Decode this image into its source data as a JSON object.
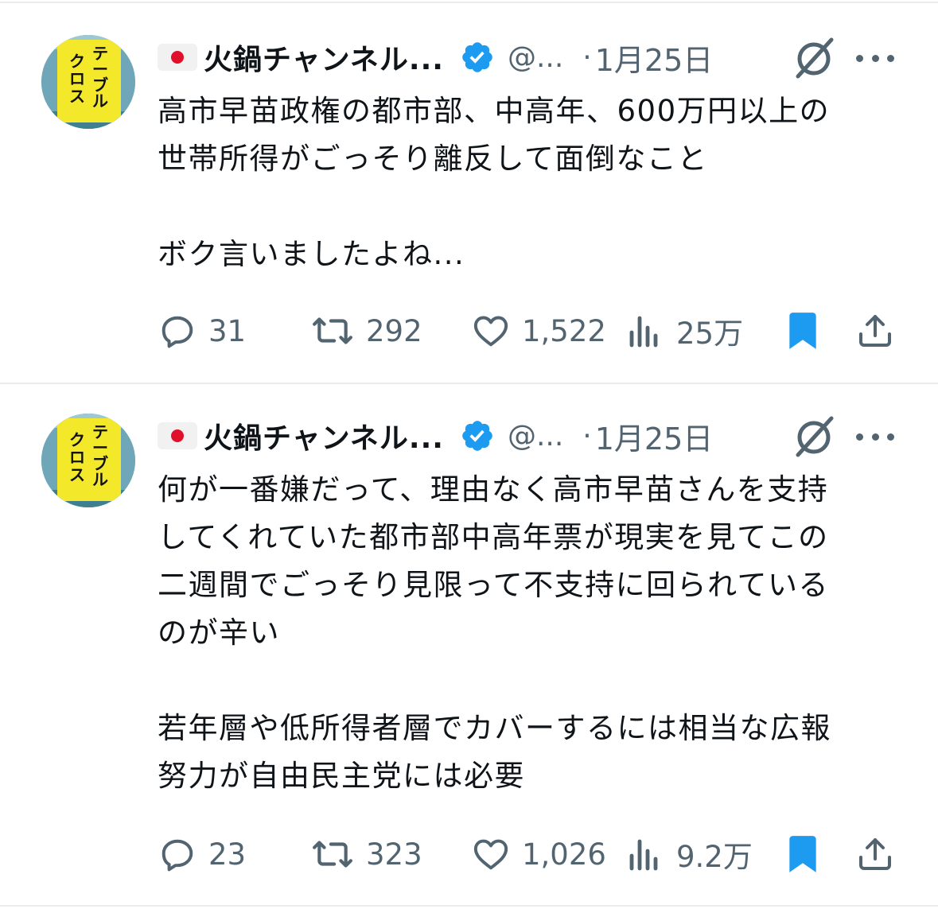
{
  "colors": {
    "text": "#0f1419",
    "muted": "#536471",
    "verified": "#1d9bf0",
    "bookmark": "#1d9bf0",
    "divider": "#e9ecef",
    "flag_red": "#e0102a"
  },
  "tweets": [
    {
      "author": {
        "avatar_text": "テーブルクロス",
        "flag_icon": "japan-flag-icon",
        "name": "火鍋チャンネル...",
        "verified_icon": "verified-badge-icon",
        "handle": "@...",
        "separator": "·",
        "date": "1月25日"
      },
      "text_lines": [
        "高市早苗政権の都市部、中高年、600万円以上の",
        "世帯所得がごっそり離反して面倒なこと",
        "",
        "ボク言いましたよね..."
      ],
      "stats": {
        "replies": "31",
        "retweets": "292",
        "likes": "1,522",
        "views": "25万"
      },
      "bookmarked": true
    },
    {
      "author": {
        "avatar_text": "テーブルクロス",
        "flag_icon": "japan-flag-icon",
        "name": "火鍋チャンネル...",
        "verified_icon": "verified-badge-icon",
        "handle": "@...",
        "separator": "·",
        "date": "1月25日"
      },
      "text_lines": [
        "何が一番嫌だって、理由なく高市早苗さんを支持",
        "してくれていた都市部中高年票が現実を見てこの",
        "二週間でごっそり見限って不支持に回られている",
        "のが辛い",
        "",
        "若年層や低所得者層でカバーするには相当な広報",
        "努力が自由民主党には必要"
      ],
      "stats": {
        "replies": "23",
        "retweets": "323",
        "likes": "1,026",
        "views": "9.2万"
      },
      "bookmarked": true
    }
  ]
}
